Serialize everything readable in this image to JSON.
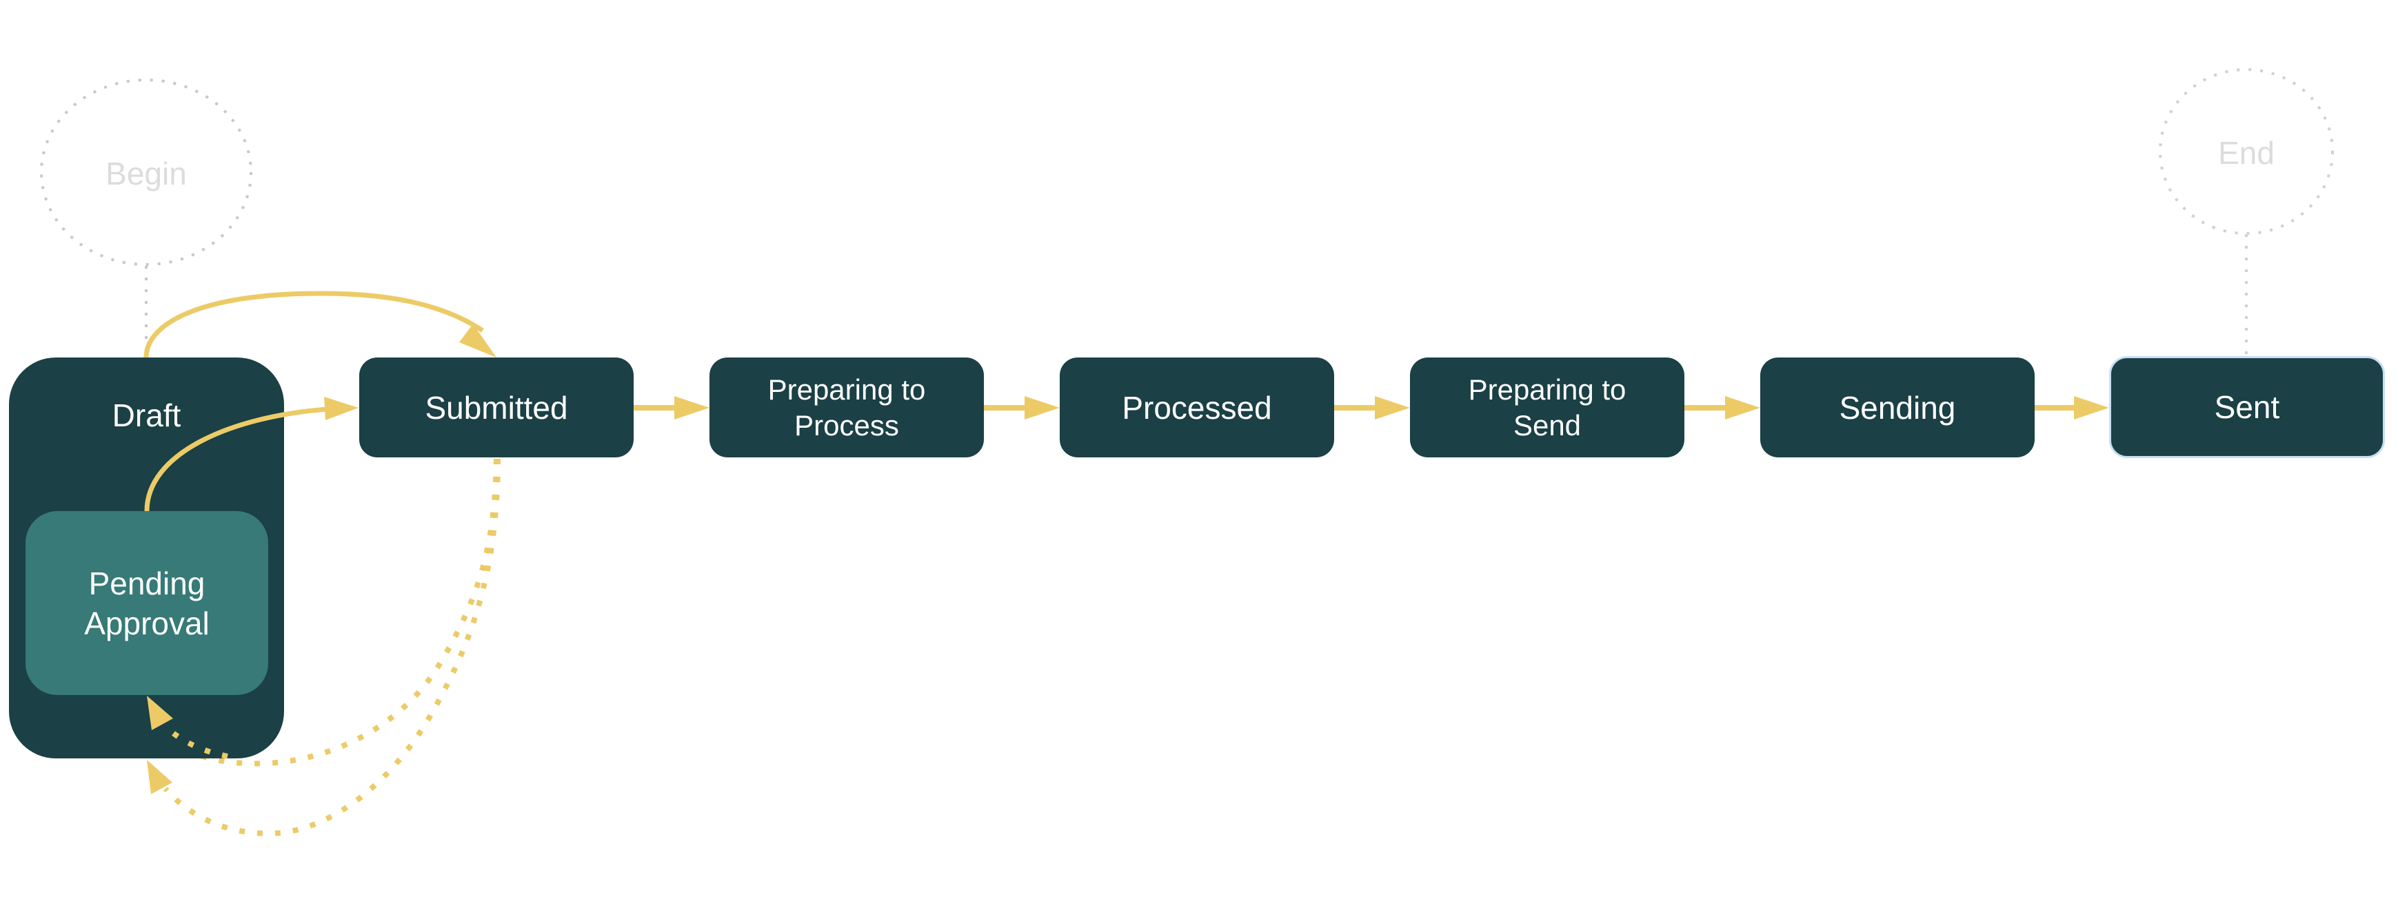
{
  "diagram": {
    "type": "state-machine",
    "colors": {
      "state_fill": "#1b4045",
      "substate_fill": "#377a77",
      "state_text": "#ffffff",
      "selected_border": "#c5def5",
      "transition": "#eccb67",
      "terminal_stroke": "#c8c8c8",
      "terminal_text": "#dcdcdc"
    },
    "terminals": {
      "begin": {
        "label": "Begin"
      },
      "end": {
        "label": "End"
      }
    },
    "draft": {
      "label": "Draft",
      "substate": {
        "label": "Pending\nApproval"
      }
    },
    "states": [
      {
        "id": "submitted",
        "label": "Submitted"
      },
      {
        "id": "preparing-to-process",
        "label": "Preparing to\nProcess"
      },
      {
        "id": "processed",
        "label": "Processed"
      },
      {
        "id": "preparing-to-send",
        "label": "Preparing to\nSend"
      },
      {
        "id": "sending",
        "label": "Sending"
      },
      {
        "id": "sent",
        "label": "Sent",
        "selected": true
      }
    ],
    "transitions": [
      {
        "from": "begin",
        "to": "draft",
        "style": "dotted-gray"
      },
      {
        "from": "draft",
        "to": "submitted",
        "style": "solid"
      },
      {
        "from": "pending-approval",
        "to": "submitted",
        "style": "solid"
      },
      {
        "from": "submitted",
        "to": "preparing-to-process",
        "style": "solid"
      },
      {
        "from": "preparing-to-process",
        "to": "processed",
        "style": "solid"
      },
      {
        "from": "processed",
        "to": "preparing-to-send",
        "style": "solid"
      },
      {
        "from": "preparing-to-send",
        "to": "sending",
        "style": "solid"
      },
      {
        "from": "sending",
        "to": "sent",
        "style": "solid"
      },
      {
        "from": "submitted",
        "to": "pending-approval",
        "style": "dotted"
      },
      {
        "from": "submitted",
        "to": "draft",
        "style": "dotted"
      },
      {
        "from": "sent",
        "to": "end",
        "style": "dotted-gray"
      }
    ]
  }
}
